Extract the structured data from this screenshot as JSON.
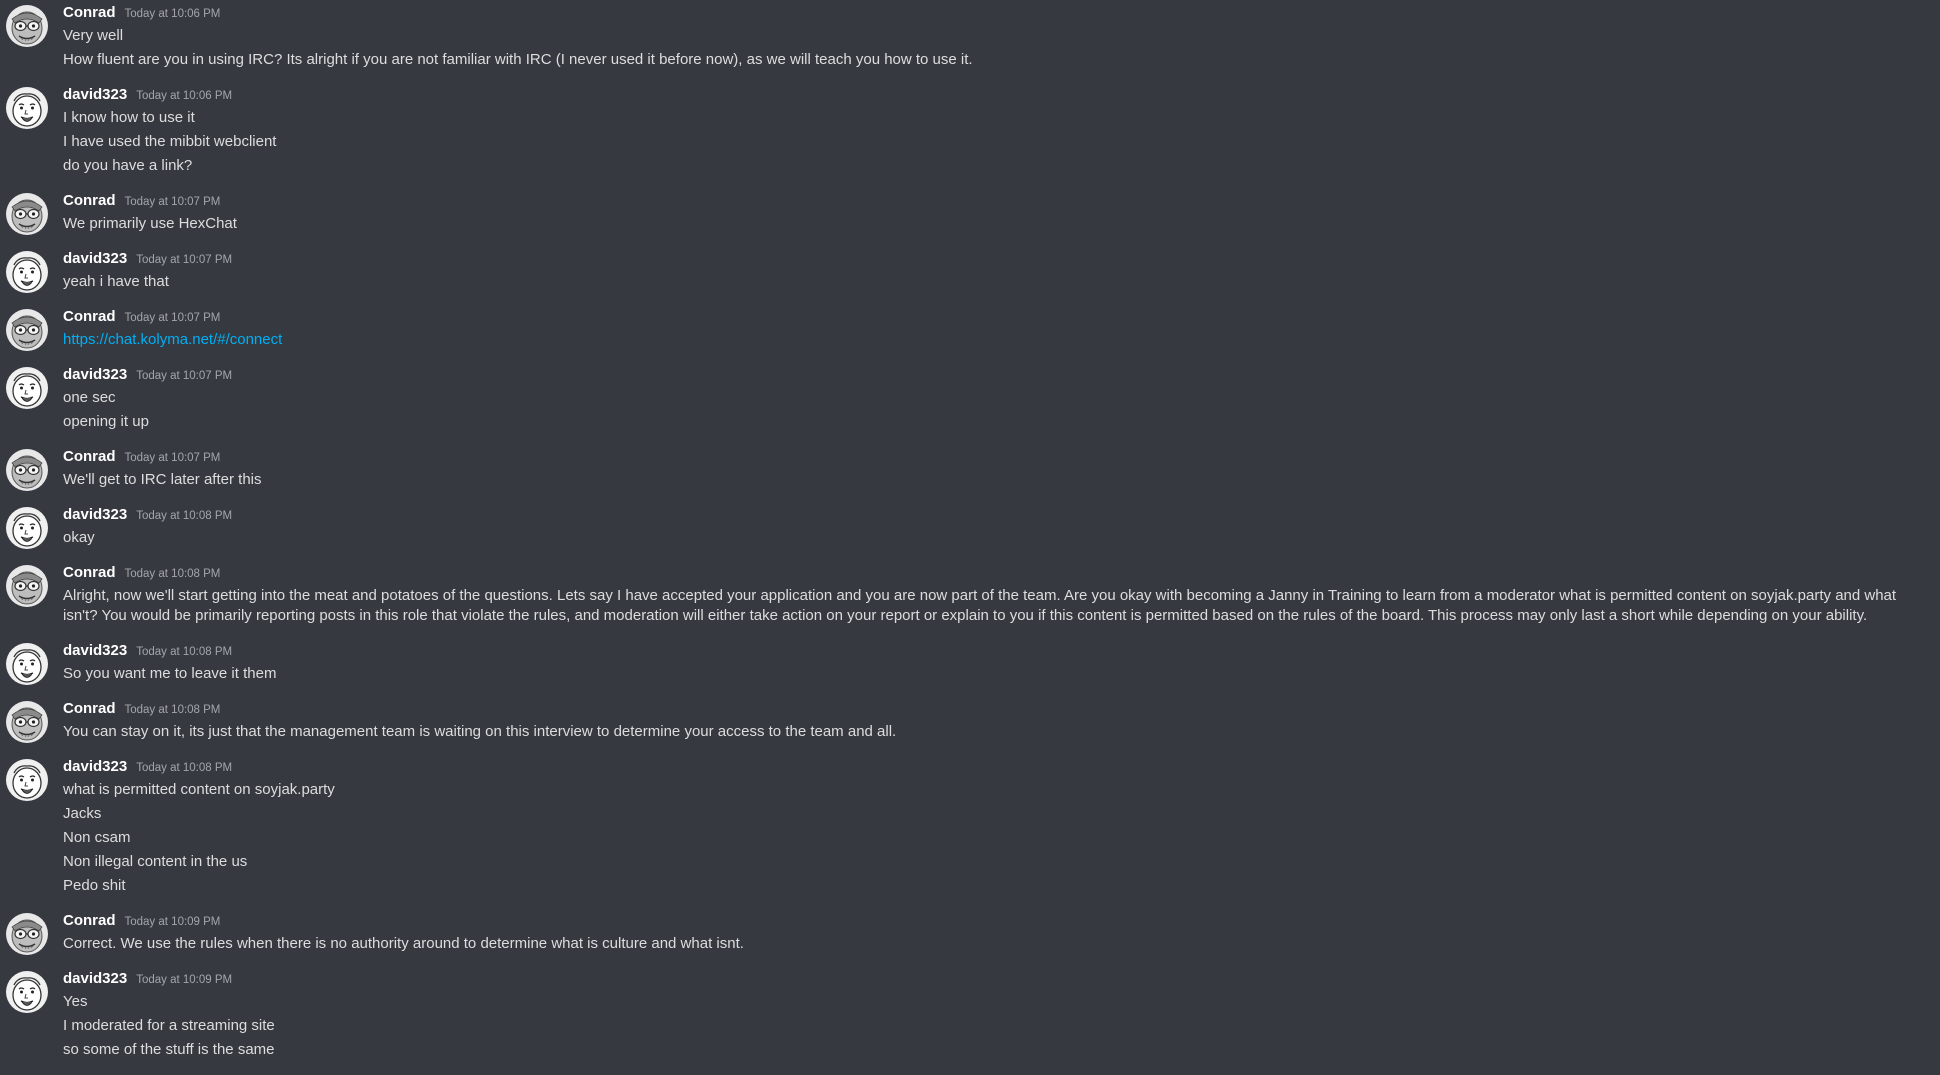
{
  "messages": [
    {
      "author": "Conrad",
      "time": "Today at 10:06 PM",
      "avatar": "conrad",
      "lines": [
        "Very well",
        "How fluent are you in using IRC? Its alright if you are not familiar with IRC (I never used it before now), as we will teach you how to use it."
      ]
    },
    {
      "author": "david323",
      "time": "Today at 10:06 PM",
      "avatar": "david",
      "lines": [
        "I know how to use it",
        "I have used the mibbit webclient",
        "do you have a link?"
      ]
    },
    {
      "author": "Conrad",
      "time": "Today at 10:07 PM",
      "avatar": "conrad",
      "lines": [
        "We primarily use HexChat"
      ]
    },
    {
      "author": "david323",
      "time": "Today at 10:07 PM",
      "avatar": "david",
      "lines": [
        "yeah i have that"
      ]
    },
    {
      "author": "Conrad",
      "time": "Today at 10:07 PM",
      "avatar": "conrad",
      "link": "https://chat.kolyma.net/#/connect"
    },
    {
      "author": "david323",
      "time": "Today at 10:07 PM",
      "avatar": "david",
      "lines": [
        "one sec",
        "opening it up"
      ]
    },
    {
      "author": "Conrad",
      "time": "Today at 10:07 PM",
      "avatar": "conrad",
      "lines": [
        "We'll get to IRC later after this"
      ]
    },
    {
      "author": "david323",
      "time": "Today at 10:08 PM",
      "avatar": "david",
      "lines": [
        "okay"
      ]
    },
    {
      "author": "Conrad",
      "time": "Today at 10:08 PM",
      "avatar": "conrad",
      "paragraph": "Alright, now we'll start getting into the meat and potatoes of the questions. Lets say I have accepted your application and you are now part of the team. Are you okay with becoming a Janny in Training to learn from a moderator what is permitted content on soyjak.party and what isn't? You would be primarily reporting posts in this role that violate the rules, and moderation will either take action on your report or explain to you if this content is permitted based on the rules of the board. This process may only last a short while depending on your ability."
    },
    {
      "author": "david323",
      "time": "Today at 10:08 PM",
      "avatar": "david",
      "lines": [
        "So you want me to leave it them"
      ]
    },
    {
      "author": "Conrad",
      "time": "Today at 10:08 PM",
      "avatar": "conrad",
      "lines": [
        "You can stay on it, its just that the management team is waiting on this interview to determine your access to the team and all."
      ]
    },
    {
      "author": "david323",
      "time": "Today at 10:08 PM",
      "avatar": "david",
      "lines": [
        "what is permitted content on soyjak.party",
        "Jacks",
        "Non csam",
        "Non illegal content in the us",
        "Pedo shit"
      ]
    },
    {
      "author": "Conrad",
      "time": "Today at 10:09 PM",
      "avatar": "conrad",
      "lines": [
        "Correct. We use the rules when there is no authority around to determine what is culture and what isnt."
      ]
    },
    {
      "author": "david323",
      "time": "Today at 10:09 PM",
      "avatar": "david",
      "lines": [
        "Yes",
        "I moderated for a streaming site",
        "so some of the stuff is the same"
      ]
    }
  ]
}
